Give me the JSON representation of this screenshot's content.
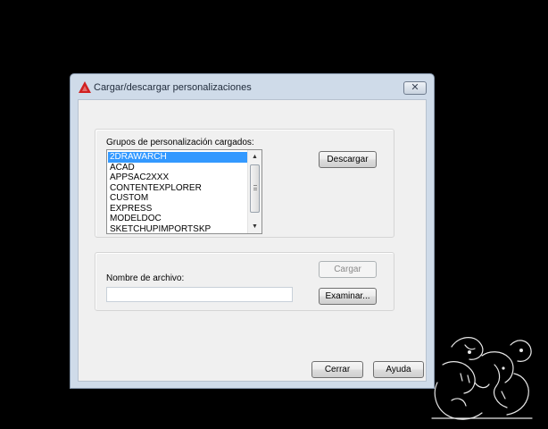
{
  "window": {
    "title": "Cargar/descargar personalizaciones",
    "icon": "autocad-logo-icon",
    "close_glyph": "✕"
  },
  "groups_section": {
    "label": "Grupos de personalización cargados:",
    "items": [
      "2DRAWARCH",
      "ACAD",
      "APPSAC2XXX",
      "CONTENTEXPLORER",
      "CUSTOM",
      "EXPRESS",
      "MODELDOC",
      "SKETCHUPIMPORTSKP"
    ],
    "selected_item": "2DRAWARCH",
    "unload_button": "Descargar"
  },
  "file_section": {
    "label": "Nombre de archivo:",
    "value": "",
    "load_button": "Cargar",
    "load_enabled": false,
    "browse_button": "Examinar..."
  },
  "footer": {
    "close_button": "Cerrar",
    "help_button": "Ayuda"
  },
  "colors": {
    "desktop": "#000000",
    "frame": "#cfdbe9",
    "client": "#f0f0f0",
    "selection": "#3399ff",
    "logo_red": "#d11f1f"
  }
}
